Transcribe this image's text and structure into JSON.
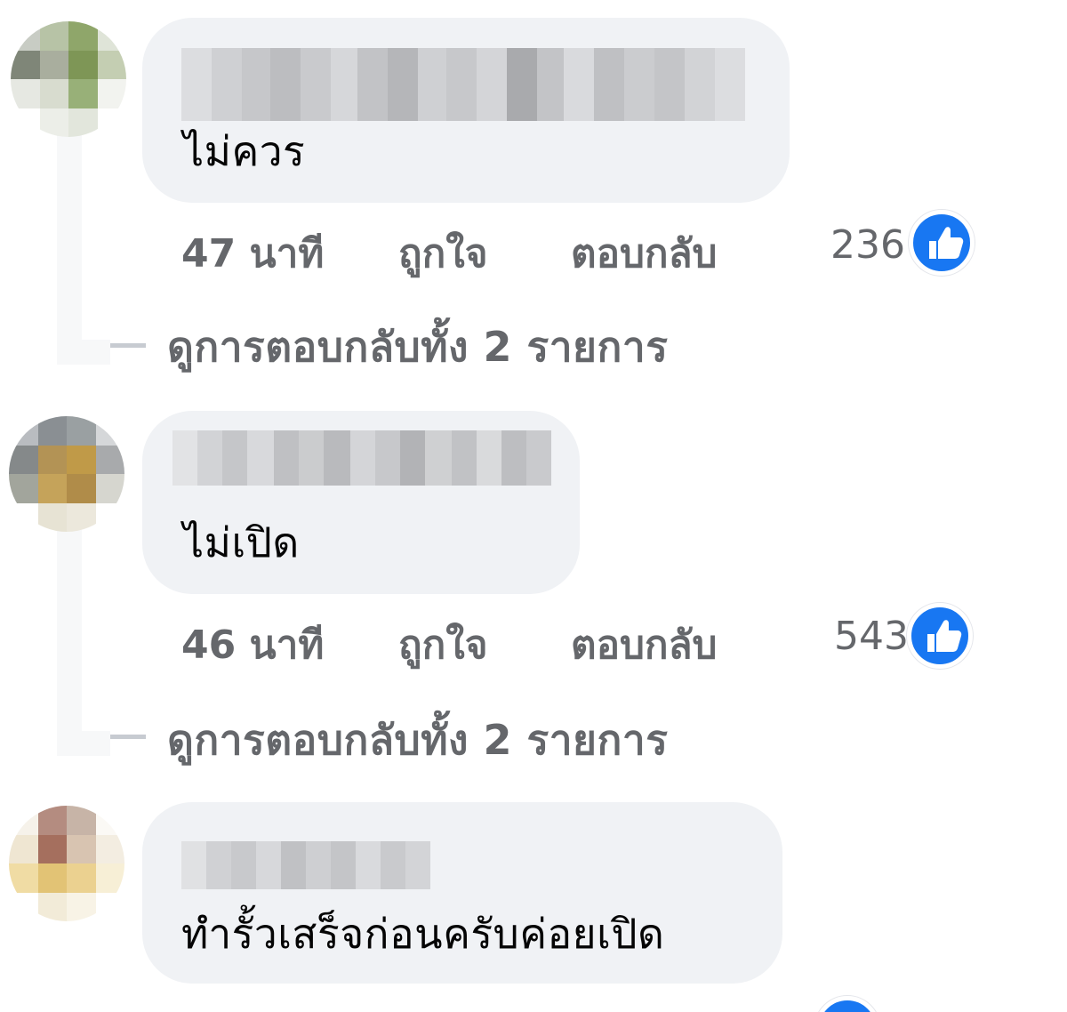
{
  "comments": [
    {
      "text": "ไม่ควร",
      "time": "47 นาที",
      "like_label": "ถูกใจ",
      "reply_label": "ตอบกลับ",
      "reaction_count": "236",
      "view_replies": "ดูการตอบกลับทั้ง 2 รายการ"
    },
    {
      "text": "ไม่เปิด",
      "time": "46 นาที",
      "like_label": "ถูกใจ",
      "reply_label": "ตอบกลับ",
      "reaction_count": "543",
      "view_replies": "ดูการตอบกลับทั้ง 2 รายการ"
    },
    {
      "text": "ทำรั้วเสร็จก่อนครับค่อยเปิด"
    }
  ],
  "colors": {
    "bubble": "#f0f2f5",
    "secondary_text": "#65676b",
    "like_blue": "#1877f2"
  },
  "icons": {
    "reaction": "thumbs-up-icon"
  }
}
